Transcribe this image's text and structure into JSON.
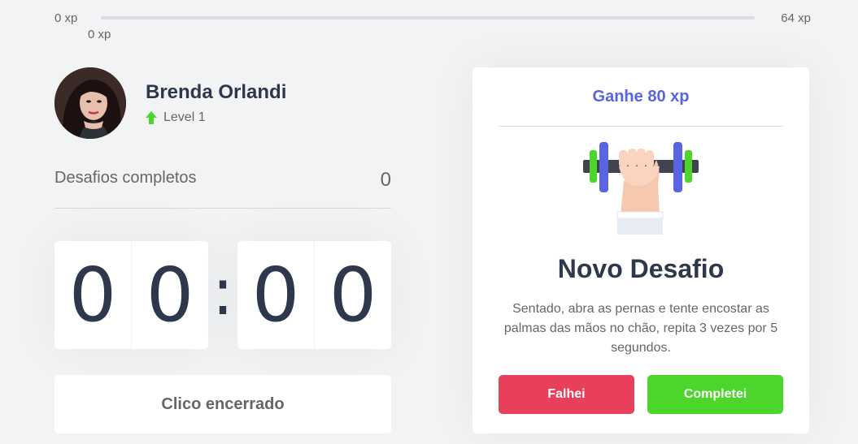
{
  "xp": {
    "min_label": "0 xp",
    "max_label": "64 xp",
    "current_label": "0 xp",
    "progress_fraction": 0
  },
  "profile": {
    "name": "Brenda Orlandi",
    "level_label": "Level 1"
  },
  "completed": {
    "label": "Desafios completos",
    "count": "0"
  },
  "countdown": {
    "minute_left": "0",
    "minute_right": "0",
    "separator": ":",
    "second_left": "0",
    "second_right": "0"
  },
  "cycle_button": {
    "label": "Clico encerrado"
  },
  "challenge": {
    "header": "Ganhe 80 xp",
    "icon": "dumbbell-arm-icon",
    "title": "Novo Desafio",
    "description": "Sentado, abra as pernas e tente encostar as palmas das mãos no chão, repita 3 vezes por 5 segundos.",
    "fail_label": "Falhei",
    "success_label": "Completei"
  },
  "colors": {
    "background": "#f2f3f5",
    "text": "#666666",
    "title": "#2e384d",
    "blue": "#5965e0",
    "green": "#4cd62b",
    "red": "#e83f5b"
  }
}
